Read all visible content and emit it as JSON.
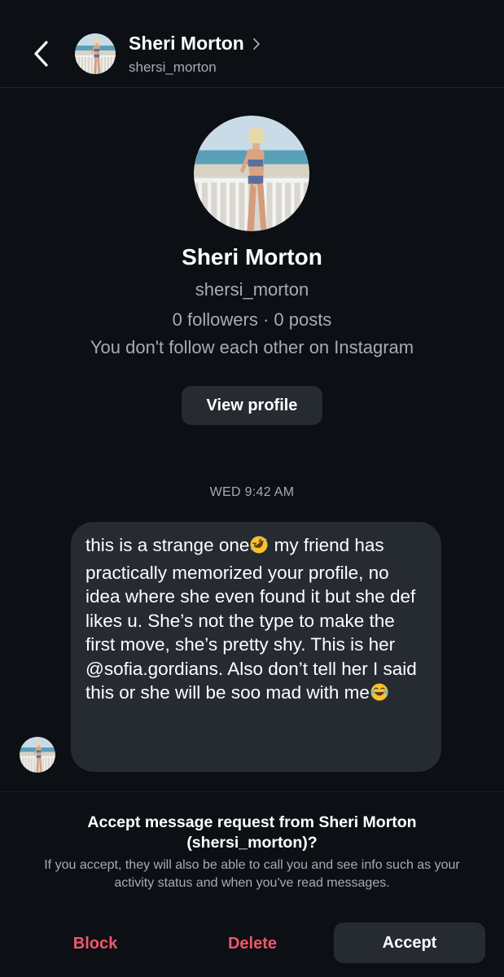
{
  "header": {
    "name": "Sheri Morton",
    "username": "shersi_morton"
  },
  "profile": {
    "name": "Sheri Morton",
    "username": "shersi_morton",
    "stats": "0 followers · 0 posts",
    "follow_status": "You don't follow each other on Instagram",
    "view_profile_label": "View profile"
  },
  "conversation": {
    "timestamp": "WED 9:42 AM",
    "message": {
      "part1": "this is a strange one",
      "part2": " my friend has practically memorized your profile, no idea where she even found it but she def likes u. She’s not the type to make the first move, she’s pretty shy. This is her @sofia.gordians. Also don’t tell her I said this or she will be soo mad with me",
      "emoji1": "rolling-on-floor-laughing-emoji",
      "emoji2": "tears-of-joy-emoji"
    }
  },
  "request": {
    "title": "Accept message request from Sheri Morton (shersi_morton)?",
    "description": "If you accept, they will also be able to call you and see info such as your activity status and when you've read messages.",
    "block_label": "Block",
    "delete_label": "Delete",
    "accept_label": "Accept"
  },
  "colors": {
    "background": "#0c0f14",
    "surface": "#262a31",
    "secondary_text": "#a7acb3",
    "destructive": "#f0566e"
  }
}
